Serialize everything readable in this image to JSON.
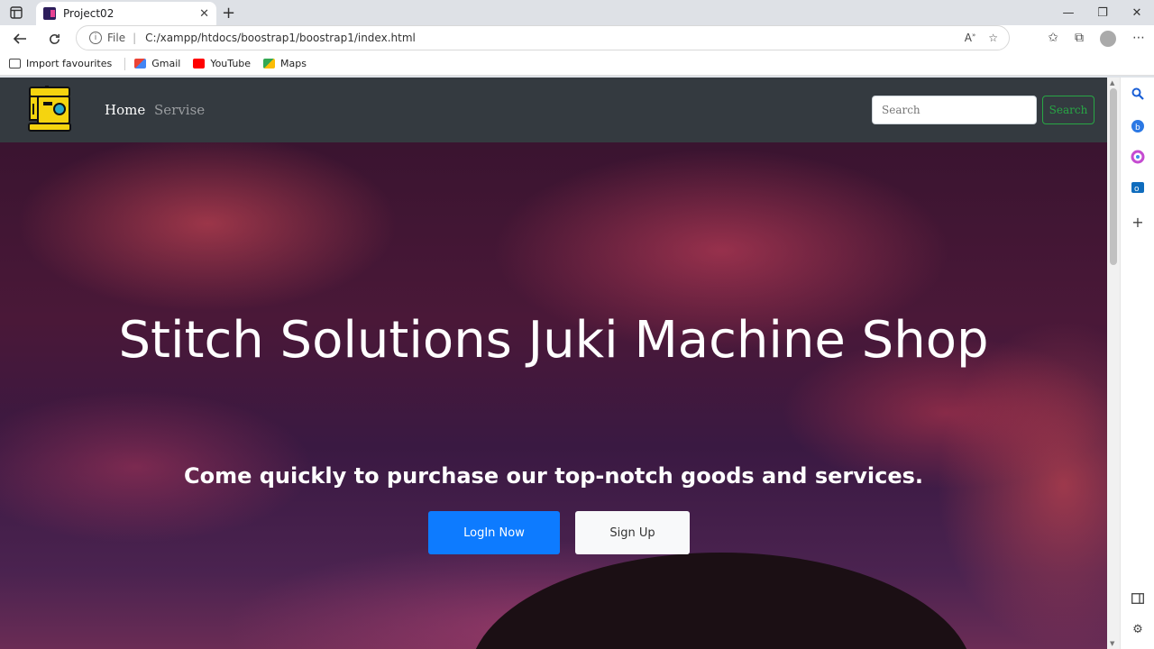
{
  "browser": {
    "tab_title": "Project02",
    "tab_close": "✕",
    "new_tab": "+",
    "address_prefix": "File",
    "address_sep": "|",
    "url": "C:/xampp/htdocs/boostrap1/boostrap1/index.html",
    "bookmarks": [
      "Import favourites",
      "Gmail",
      "YouTube",
      "Maps"
    ],
    "accent": "#dee1e6"
  },
  "navbar": {
    "home_label": "Home",
    "servise_label": "Servise",
    "search_placeholder": "Search",
    "search_button": "Search",
    "bg_color": "#343a40",
    "button_color": "#28a745"
  },
  "hero": {
    "title": "Stitch Solutions Juki Machine Shop",
    "subtitle": "Come quickly to purchase our top-notch goods and services.",
    "login_button": "LogIn Now",
    "signup_button": "Sign Up",
    "login_color": "#0d7bff"
  },
  "icons": [
    "sewing-machine-logo",
    "back-icon",
    "refresh-icon",
    "info-icon",
    "read-aloud-icon",
    "favorite-add-icon",
    "favorites-icon",
    "collections-icon",
    "profile-icon",
    "more-icon",
    "search-sidebar-icon",
    "bing-icon",
    "office-icon",
    "outlook-icon",
    "add-icon",
    "layout-icon",
    "settings-icon"
  ]
}
